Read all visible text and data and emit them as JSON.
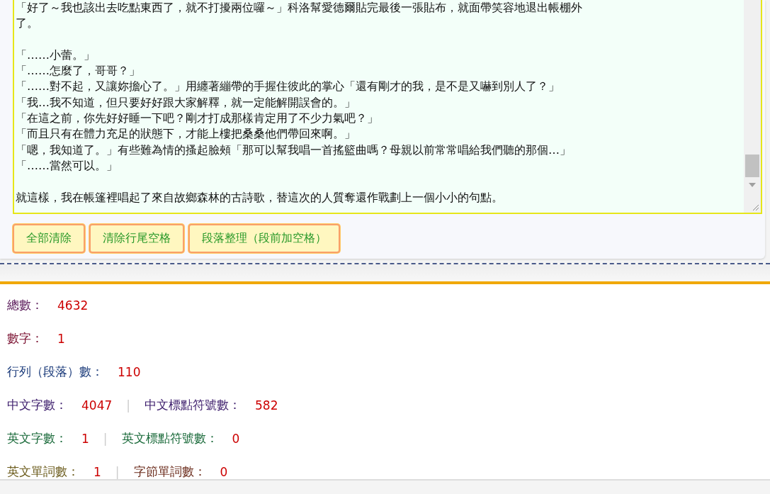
{
  "editor": {
    "paragraphs": [
      {
        "lines": [
          "「好了～我也該出去吃點東西了，就不打擾兩位囉～」科洛幫愛德爾貼完最後一張貼布，就面帶笑容地退出帳棚外",
          "了。"
        ]
      },
      {
        "lines": [
          "「……小蕾。」",
          "「……怎麼了，哥哥？」",
          "「……對不起，又讓妳擔心了。」用纏著繃帶的手握住彼此的掌心「還有剛才的我，是不是又嚇到別人了？」",
          "「我…我不知道，但只要好好跟大家解釋，就一定能解開誤會的。」",
          "「在這之前，你先好好睡一下吧？剛才打成那樣肯定用了不少力氣吧？」",
          "「而且只有在體力充足的狀態下，才能上樓把桑桑他們帶回來啊。」",
          "「嗯，我知道了。」有些難為情的搔起臉頰「那可以幫我唱一首搖籃曲嗎？母親以前常常唱給我們聽的那個…」",
          "「……當然可以。」"
        ]
      },
      {
        "lines": [
          "就這樣，我在帳篷裡唱起了來自故鄉森林的古詩歌，替這次的人質奪還作戰劃上一個小小的句點。"
        ]
      }
    ]
  },
  "buttons": [
    "全部清除",
    "清除行尾空格",
    "段落整理（段前加空格）"
  ],
  "stats": [
    {
      "items": [
        {
          "label": "總數：",
          "value": "4632",
          "color": "#5a1a5a"
        }
      ]
    },
    {
      "items": [
        {
          "label": "數字：",
          "value": "1",
          "color": "#7a1030"
        }
      ]
    },
    {
      "items": [
        {
          "label": "行列（段落）數：",
          "value": "110",
          "color": "#1a3a7a"
        }
      ]
    },
    {
      "items": [
        {
          "label": "中文字數：",
          "value": "4047",
          "color": "#3a1a6a"
        },
        {
          "label": "中文標點符號數：",
          "value": "582",
          "color": "#3a1a6a"
        }
      ],
      "separator": "|"
    },
    {
      "items": [
        {
          "label": "英文字數：",
          "value": "1",
          "color": "#1a6a3a"
        },
        {
          "label": "英文標點符號數：",
          "value": "0",
          "color": "#1a6a3a"
        }
      ],
      "separator": "|"
    },
    {
      "items": [
        {
          "label": "英文單詞數：",
          "value": "1",
          "color": "#6a5a1a"
        },
        {
          "label": "字節單詞數：",
          "value": "0",
          "color": "#6a2a1a"
        }
      ],
      "separator": "|"
    }
  ]
}
